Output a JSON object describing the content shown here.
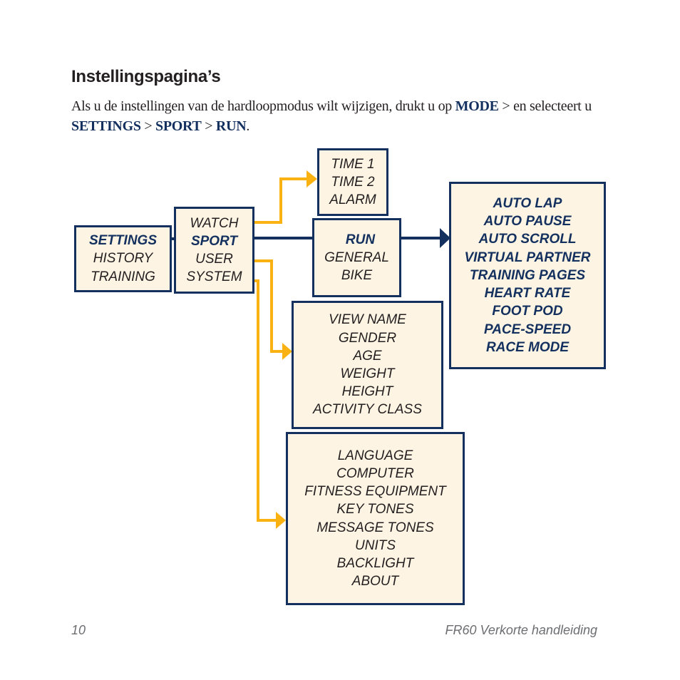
{
  "heading": "Instellingspagina’s",
  "intro": {
    "part1": "Als u de instellingen van de hardloopmodus wilt wijzigen, drukt u op ",
    "kw_mode": "MODE",
    "part2": " > en selecteert u ",
    "kw_settings": "SETTINGS",
    "sep1": " > ",
    "kw_sport": "SPORT",
    "sep2": " > ",
    "kw_run": "RUN",
    "end": "."
  },
  "colors": {
    "navy": "#13305f",
    "yellow": "#f9b212",
    "box_fill": "#fdf4e3"
  },
  "diagram": {
    "main_menu": {
      "items": [
        "SETTINGS",
        "HISTORY",
        "TRAINING"
      ],
      "highlighted": "SETTINGS"
    },
    "settings_menu": {
      "items": [
        "WATCH",
        "SPORT",
        "USER",
        "SYSTEM"
      ],
      "highlighted": "SPORT"
    },
    "watch_menu": {
      "items": [
        "TIME 1",
        "TIME 2",
        "ALARM"
      ]
    },
    "sport_menu": {
      "items": [
        "RUN",
        "GENERAL",
        "BIKE"
      ],
      "highlighted": "RUN"
    },
    "run_menu": {
      "items": [
        "AUTO LAP",
        "AUTO PAUSE",
        "AUTO SCROLL",
        "VIRTUAL PARTNER",
        "TRAINING PAGES",
        "HEART RATE",
        "FOOT POD",
        "PACE-SPEED",
        "RACE MODE"
      ]
    },
    "user_menu": {
      "items": [
        "VIEW NAME",
        "GENDER",
        "AGE",
        "WEIGHT",
        "HEIGHT",
        "ACTIVITY CLASS"
      ]
    },
    "system_menu": {
      "items": [
        "LANGUAGE",
        "COMPUTER",
        "FITNESS EQUIPMENT",
        "KEY TONES",
        "MESSAGE TONES",
        "UNITS",
        "BACKLIGHT",
        "ABOUT"
      ]
    }
  },
  "footer": {
    "page_number": "10",
    "doc_title": "FR60 Verkorte handleiding"
  }
}
